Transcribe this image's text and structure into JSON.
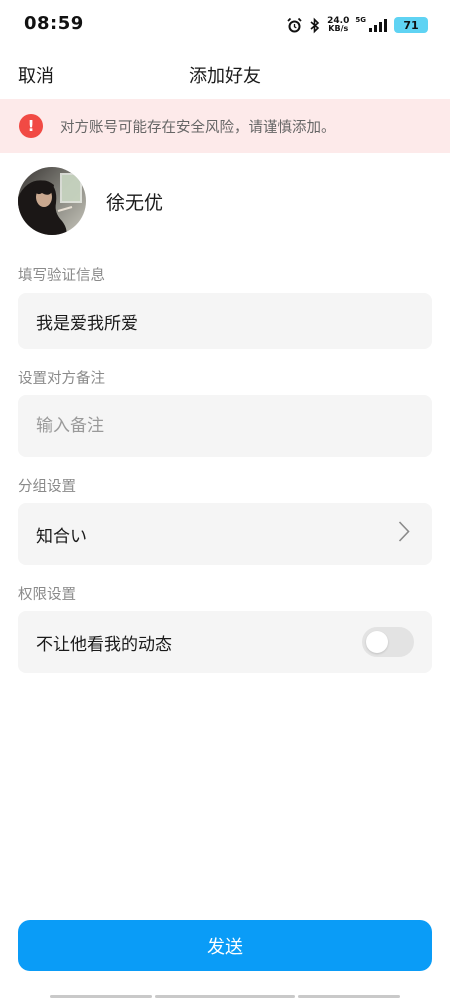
{
  "status_bar": {
    "time": "08:59",
    "net_speed_value": "24.0",
    "net_speed_unit": "KB/s",
    "network": "5G",
    "battery": "71",
    "icons": [
      "alarm-icon",
      "bluetooth-icon",
      "signal-icon"
    ]
  },
  "nav": {
    "cancel_label": "取消",
    "title": "添加好友"
  },
  "warning": {
    "text": "对方账号可能存在安全风险，请谨慎添加。",
    "icon": "alert-icon",
    "icon_glyph": "!",
    "color": "#f14a44",
    "background": "#fdeaea"
  },
  "profile": {
    "name": "徐无优"
  },
  "verification": {
    "label": "填写验证信息",
    "value": "我是爱我所爱"
  },
  "remark": {
    "label": "设置对方备注",
    "placeholder": "输入备注",
    "value": ""
  },
  "group": {
    "label": "分组设置",
    "value": "知合い"
  },
  "permissions": {
    "label": "权限设置",
    "hide_moments_label": "不让他看我的动态",
    "hide_moments_enabled": false
  },
  "send_button": {
    "label": "发送",
    "color": "#0a9cf7"
  }
}
